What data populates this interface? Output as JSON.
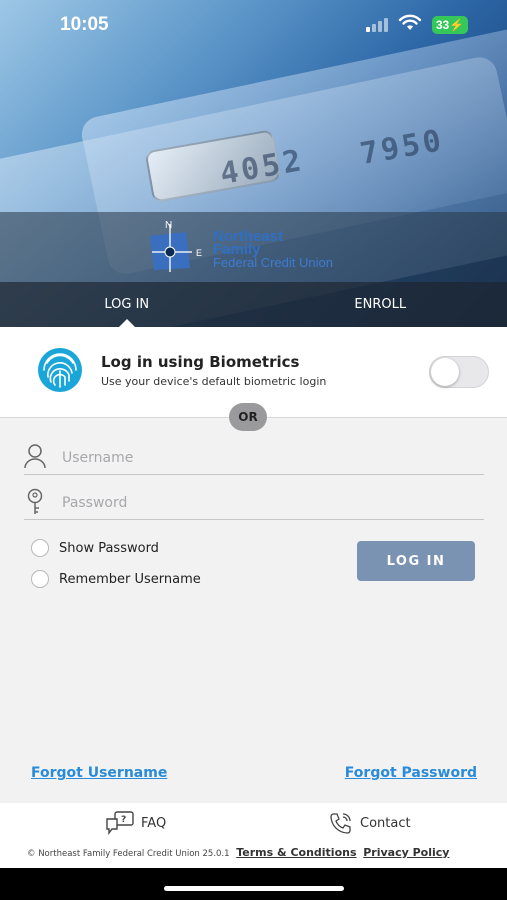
{
  "status_bar": {
    "time": "10:05",
    "battery": "33"
  },
  "brand": {
    "line1": "Northeast",
    "line2": "Family",
    "line3": "Federal Credit Union",
    "compass_n": "N",
    "compass_e": "E"
  },
  "card": {
    "digits1": "4052",
    "digits2": "7950"
  },
  "tabs": [
    {
      "label": "LOG IN",
      "active": true
    },
    {
      "label": "ENROLL",
      "active": false
    }
  ],
  "biometrics": {
    "title": "Log in using Biometrics",
    "subtitle": "Use your device's default biometric login",
    "enabled": false
  },
  "divider": {
    "label": "OR"
  },
  "form": {
    "username": {
      "placeholder": "Username",
      "value": ""
    },
    "password": {
      "placeholder": "Password",
      "value": ""
    },
    "show_password": "Show Password",
    "remember_username": "Remember Username",
    "submit_label": "LOG IN"
  },
  "links": {
    "forgot_username": "Forgot Username",
    "forgot_password": "Forgot Password"
  },
  "footer": {
    "faq": "FAQ",
    "contact": "Contact",
    "copyright": "© Northeast Family Federal Credit Union 25.0.1",
    "terms": "Terms & Conditions",
    "privacy": "Privacy Policy"
  },
  "colors": {
    "accent_link": "#2a8bd8",
    "login_button": "#7a93b3",
    "brand_blue": "#2f6fc4",
    "battery": "#34c759"
  }
}
